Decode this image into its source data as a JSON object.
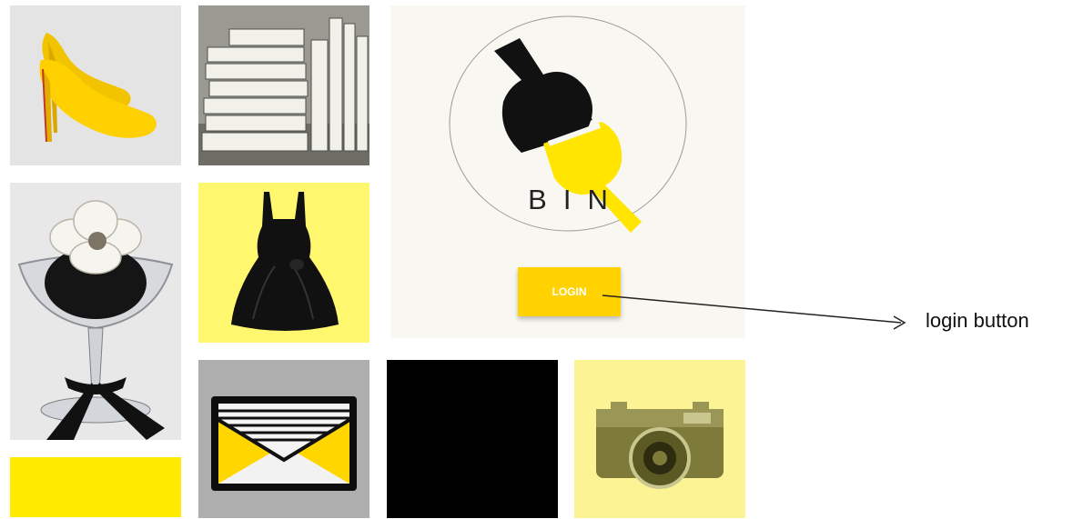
{
  "login_panel": {
    "logo_text": "BIN",
    "login_button_label": "LOGIN"
  },
  "annotation": {
    "label": "login button"
  },
  "tiles": {
    "shoes": {
      "icon": "yellow-heels-image"
    },
    "books": {
      "icon": "books-image"
    },
    "cupcake": {
      "icon": "cupcake-image"
    },
    "dress": {
      "icon": "black-dress-image"
    },
    "yellow_block": {
      "color": "#ffea00"
    },
    "clutch": {
      "icon": "clutch-bag-image"
    },
    "black_block": {
      "color": "#000000"
    },
    "camera": {
      "icon": "camera-image"
    }
  },
  "colors": {
    "accent_yellow": "#ffd200",
    "panel_bg": "#f8f7f1"
  }
}
